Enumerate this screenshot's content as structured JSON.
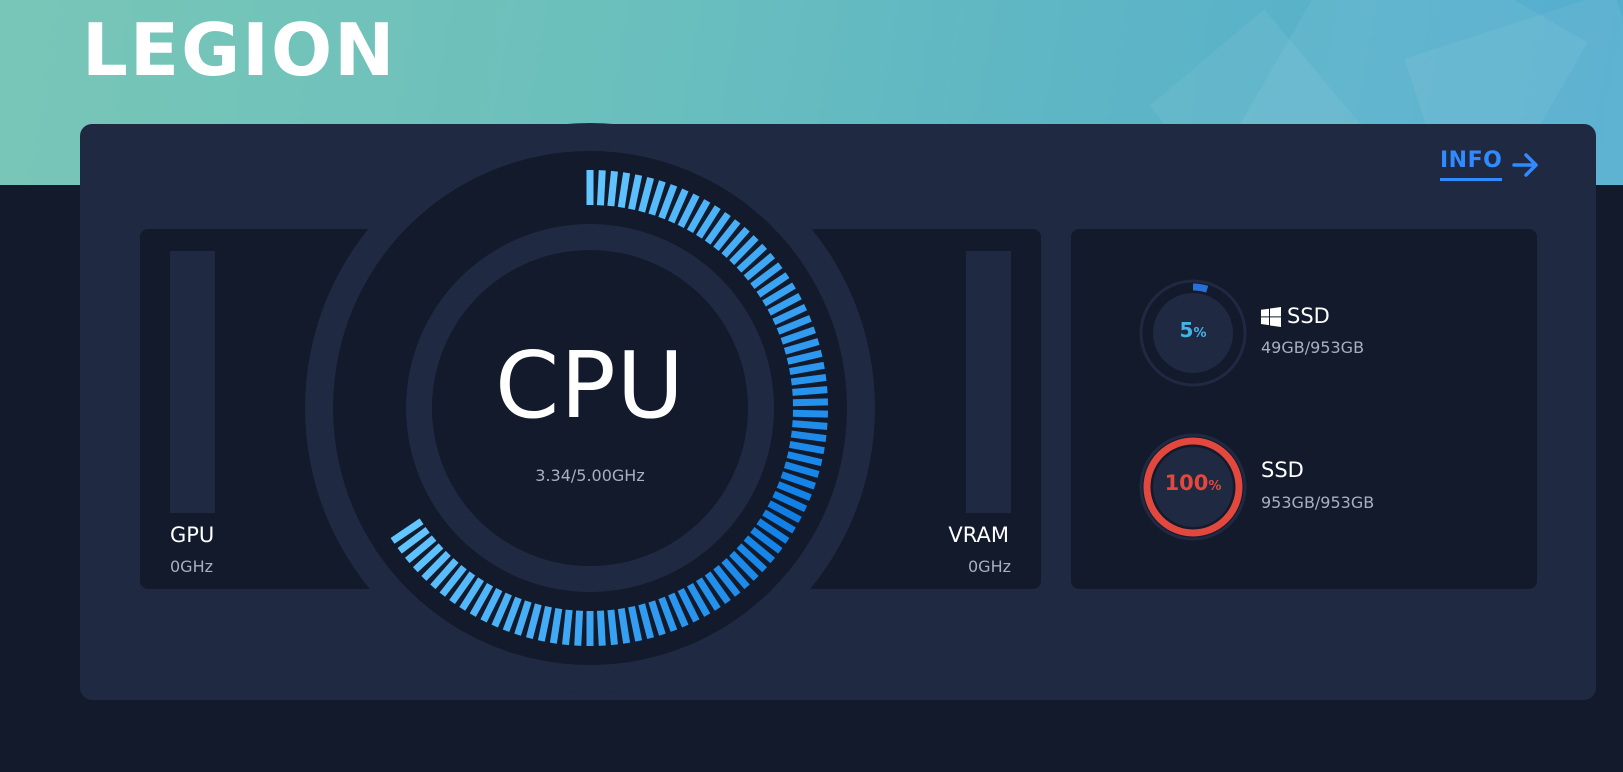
{
  "brand": {
    "logo_text": "LEGION"
  },
  "header": {
    "info_label": "INFO"
  },
  "cpu": {
    "label": "CPU",
    "frequency": "3.34/5.00GHz",
    "current_ghz": 3.34,
    "max_ghz": 5.0,
    "usage_fraction": 0.668
  },
  "gpu": {
    "label": "GPU",
    "frequency": "0GHz",
    "usage_fraction": 0
  },
  "vram": {
    "label": "VRAM",
    "frequency": "0GHz",
    "usage_fraction": 0
  },
  "disks": [
    {
      "label": "SSD",
      "percent": "5",
      "unit": "%",
      "usage_fraction": 0.05,
      "capacity": "49GB/953GB",
      "system_drive": true,
      "color": "#2a6fd6",
      "text_color": "#3fb6e6"
    },
    {
      "label": "SSD",
      "percent": "100",
      "unit": "%",
      "usage_fraction": 1.0,
      "capacity": "953GB/953GB",
      "system_drive": false,
      "color": "#e2483d",
      "text_color": "#e2483d"
    }
  ],
  "colors": {
    "background": "#121a2b",
    "panel": "#1f2942",
    "accent": "#2f8bff",
    "gauge_light": "#63c6ff",
    "gauge_dark": "#0f7fe6"
  },
  "icons": {
    "info_arrow": "arrow-right-icon",
    "system_drive": "windows-logo-icon"
  }
}
